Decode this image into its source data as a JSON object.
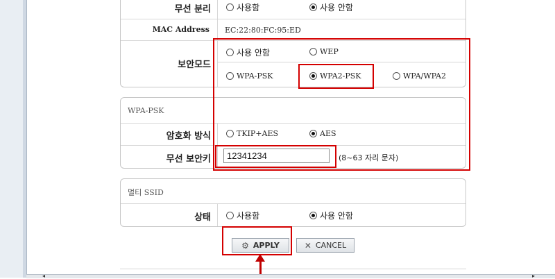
{
  "wireless_separation": {
    "label": "무선 분리",
    "options": [
      "사용함",
      "사용 안함"
    ],
    "selected": "사용 안함"
  },
  "mac_address": {
    "label": "MAC Address",
    "value": "EC:22:80:FC:95:ED"
  },
  "security_mode": {
    "label": "보안모드",
    "options": [
      "사용 안함",
      "WEP",
      "WPA-PSK",
      "WPA2-PSK",
      "WPA/WPA2"
    ],
    "selected": "WPA2-PSK"
  },
  "wpa_psk": {
    "section_title": "WPA-PSK",
    "encryption_label": "암호화 방식",
    "encryption_options": [
      "TKIP+AES",
      "AES"
    ],
    "encryption_selected": "AES",
    "key_label": "무선 보안키",
    "key_value": "12341234",
    "key_hint": "(8~63 자리 문자)"
  },
  "multi_ssid": {
    "section_title": "멀티 SSID",
    "status_label": "상태",
    "options": [
      "사용함",
      "사용 안함"
    ],
    "selected": "사용 안함"
  },
  "buttons": {
    "apply": "APPLY",
    "cancel": "CANCEL",
    "apply_icon": "gear-icon",
    "cancel_icon": "close-icon"
  },
  "highlight_color": "#d40000",
  "arrow_color": "#c00000"
}
